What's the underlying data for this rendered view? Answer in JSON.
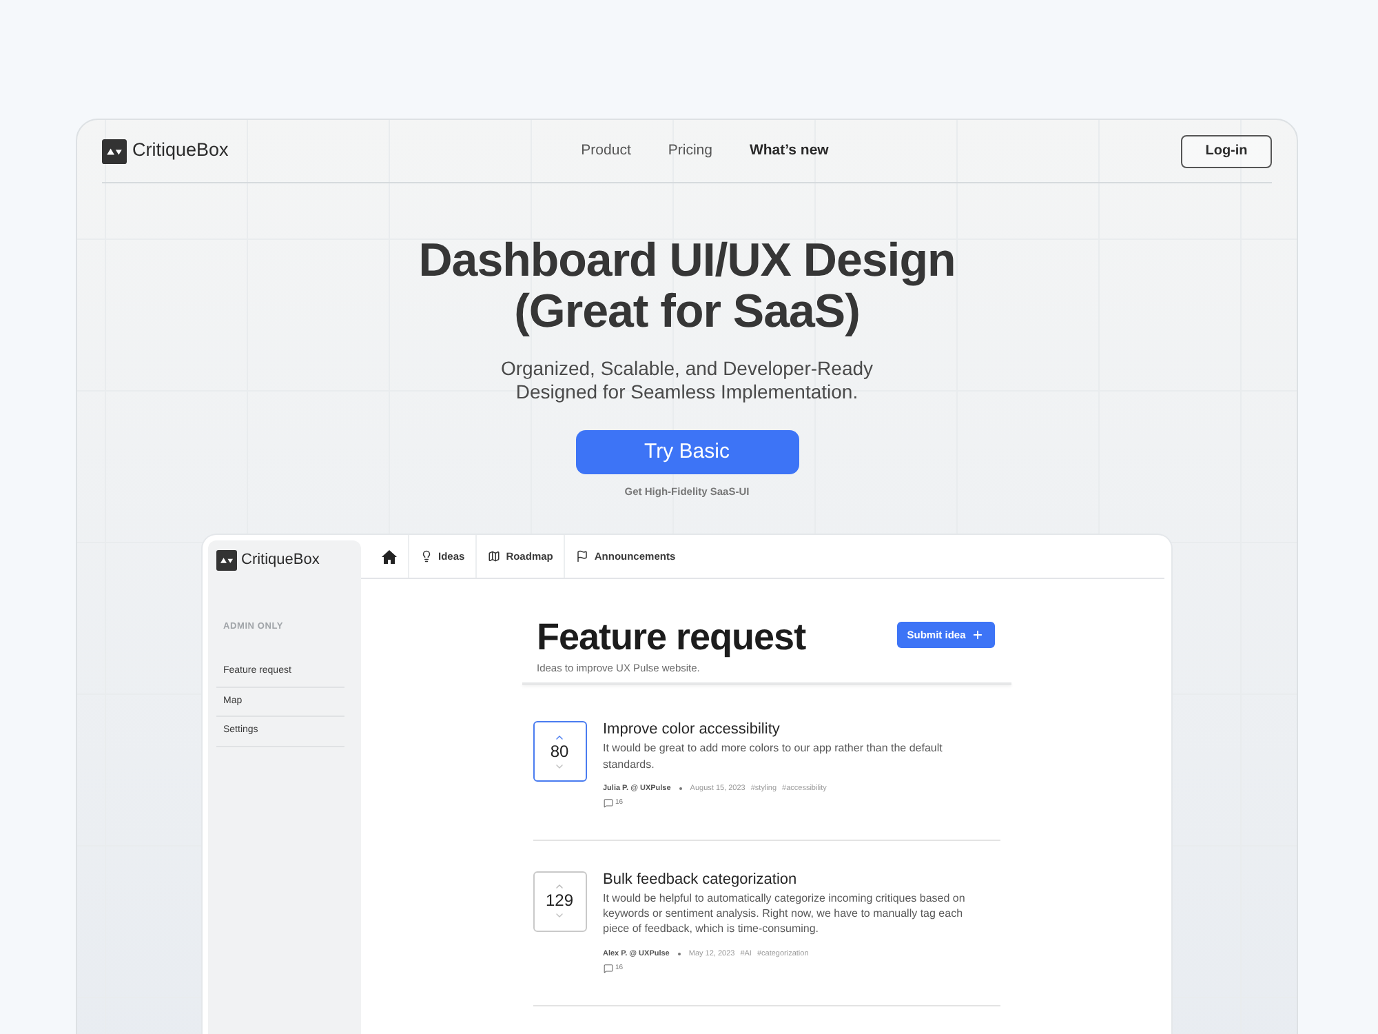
{
  "nav": {
    "brand": "CritiqueBox",
    "links": [
      {
        "label": "Product",
        "selected": false
      },
      {
        "label": "Pricing",
        "selected": false
      },
      {
        "label": "What’s new",
        "selected": true
      }
    ],
    "login_button": "Log-in"
  },
  "hero": {
    "title_lines": [
      "Dashboard UI/UX Design",
      "(Great for SaaS)"
    ],
    "subtitle_lines": [
      "Organized, Scalable, and Developer-Ready",
      "Designed for Seamless Implementation."
    ],
    "cta_button": "Try Basic",
    "cta_caption": "Get High-Fidelity SaaS-UI"
  },
  "app": {
    "brand": "CritiqueBox",
    "sidebar": {
      "section_label": "ADMIN ONLY",
      "items": [
        "Feature request",
        "Map",
        "Settings"
      ]
    },
    "top_nav": [
      "Ideas",
      "Roadmap",
      "Announcements"
    ],
    "page": {
      "title": "Feature request",
      "subtitle": "Ideas to improve UX Pulse website.",
      "submit_button": "Submit idea"
    },
    "requests": [
      {
        "votes": "80",
        "voted": true,
        "title": "Improve color accessibility",
        "description": "It would be great to add more colors to our app rather than the default standards.",
        "author": "Julia P. @ UXPulse",
        "date": "August 15, 2023",
        "tags": [
          "#styling",
          "#accessibility"
        ],
        "comments": "16"
      },
      {
        "votes": "129",
        "voted": false,
        "title": "Bulk feedback categorization",
        "description": "It would be helpful to automatically categorize incoming critiques based on keywords or sentiment analysis. Right now, we have to manually tag each piece of feedback, which is time-consuming.",
        "author": "Alex P. @ UXPulse",
        "date": "May 12, 2023",
        "tags": [
          "#AI",
          "#categorization"
        ],
        "comments": "16"
      }
    ]
  }
}
